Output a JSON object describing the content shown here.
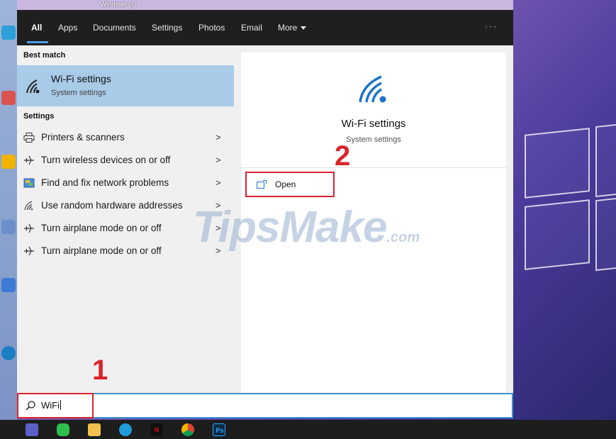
{
  "top_strip_text": "Windows (>)",
  "tabs": [
    {
      "label": "All",
      "active": true
    },
    {
      "label": "Apps"
    },
    {
      "label": "Documents"
    },
    {
      "label": "Settings"
    },
    {
      "label": "Photos"
    },
    {
      "label": "Email"
    },
    {
      "label": "More"
    }
  ],
  "ellipsis": "···",
  "best_match": {
    "heading": "Best match",
    "title": "Wi-Fi settings",
    "subtitle": "System settings",
    "icon": "wifi-icon"
  },
  "settings": {
    "heading": "Settings",
    "items": [
      {
        "label": "Printers & scanners",
        "icon": "printer-icon"
      },
      {
        "label": "Turn wireless devices on or off",
        "icon": "airplane-icon"
      },
      {
        "label": "Find and fix network problems",
        "icon": "troubleshoot-icon"
      },
      {
        "label": "Use random hardware addresses",
        "icon": "wifi-icon"
      },
      {
        "label": "Turn airplane mode on or off",
        "icon": "airplane-icon"
      },
      {
        "label": "Turn airplane mode on or off",
        "icon": "airplane-icon"
      }
    ],
    "chevron": ">"
  },
  "preview": {
    "title": "Wi-Fi settings",
    "subtitle": "System settings",
    "open_label": "Open",
    "icon": "wifi-icon"
  },
  "callouts": {
    "one": "1",
    "two": "2"
  },
  "watermark": {
    "main": "TipsMake",
    "suffix": ".com"
  },
  "search": {
    "value": "WiFi"
  },
  "taskbar": {
    "ps_label": "Ps",
    "netflix_label": "N"
  },
  "colors": {
    "accent": "#4c9be8",
    "highlight": "#a8cbe8",
    "callout": "#d9242b"
  }
}
